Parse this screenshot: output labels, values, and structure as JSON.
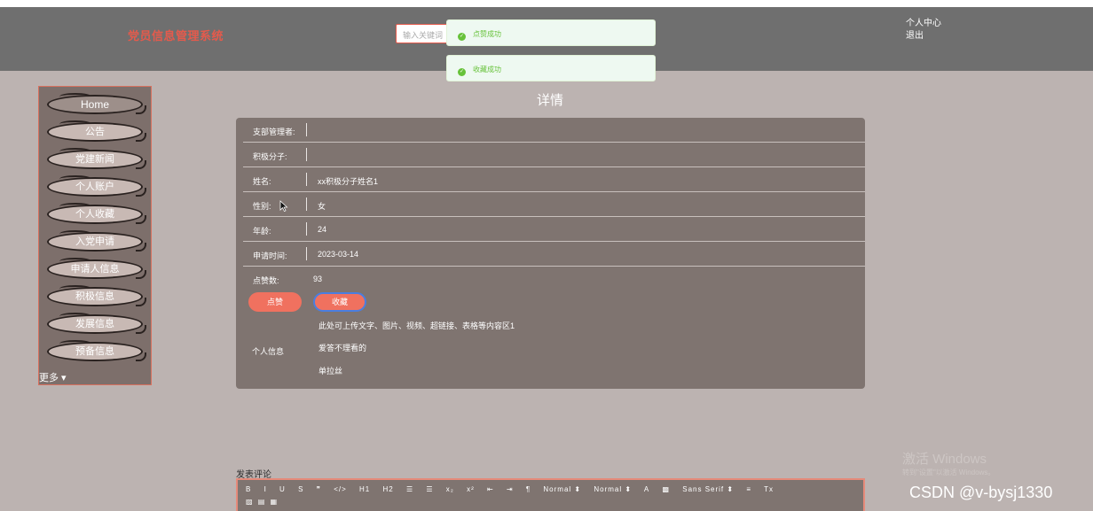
{
  "header": {
    "site_title": "党员信息管理系统",
    "search_placeholder": "输入关键词",
    "user_center": "个人中心",
    "logout": "退出"
  },
  "toasts": [
    {
      "text": "点赞成功",
      "color": "#67c23a"
    },
    {
      "text": "收藏成功",
      "color": "#67c23a"
    }
  ],
  "sidebar": {
    "items": [
      {
        "label": "Home"
      },
      {
        "label": "公告"
      },
      {
        "label": "党建新闻"
      },
      {
        "label": "个人账户"
      },
      {
        "label": "个人收藏"
      },
      {
        "label": "入党申请"
      },
      {
        "label": "申请人信息"
      },
      {
        "label": "积极信息"
      },
      {
        "label": "发展信息"
      },
      {
        "label": "预备信息"
      }
    ],
    "more": "更多 ▾"
  },
  "detail": {
    "title": "详情",
    "fields": [
      {
        "label": "支部管理者:",
        "value": ""
      },
      {
        "label": "积极分子:",
        "value": ""
      },
      {
        "label": "姓名:",
        "value": "xx积极分子姓名1"
      },
      {
        "label": "性别:",
        "value": "女"
      },
      {
        "label": "年龄:",
        "value": "24"
      },
      {
        "label": "申请时间:",
        "value": "2023-03-14"
      }
    ],
    "likes_label": "点赞数:",
    "likes_value": "93",
    "like_button": "点赞",
    "favorite_button": "收藏",
    "info_label": "个人信息",
    "info_lines": [
      "此处可上传文字、图片、视频、超链接、表格等内容区1",
      "爱答不理看的",
      "单拉丝"
    ]
  },
  "comment": {
    "title": "发表评论",
    "toolbar": [
      "B",
      "I",
      "U",
      "S",
      "❞",
      "</>",
      "H1",
      "H2",
      "☰",
      "☰",
      "x₂",
      "x²",
      "⇤",
      "⇥",
      "¶",
      "Normal ⬍",
      "Normal ⬍",
      "A",
      "▩",
      "Sans Serif ⬍",
      "≡",
      "Tx"
    ],
    "toolbar_row2": "▨ ▤ ▦"
  },
  "watermark": {
    "line1": "激活 Windows",
    "line2": "转到\"设置\"以激活 Windows。",
    "csdn": "CSDN @v-bysj1330"
  },
  "colors": {
    "accent": "#e55a4c",
    "button": "#f0715f",
    "header_bg": "#6f6f6f",
    "panel_bg": "#7f7470",
    "page_bg": "#bcb3b1",
    "success": "#67c23a"
  }
}
